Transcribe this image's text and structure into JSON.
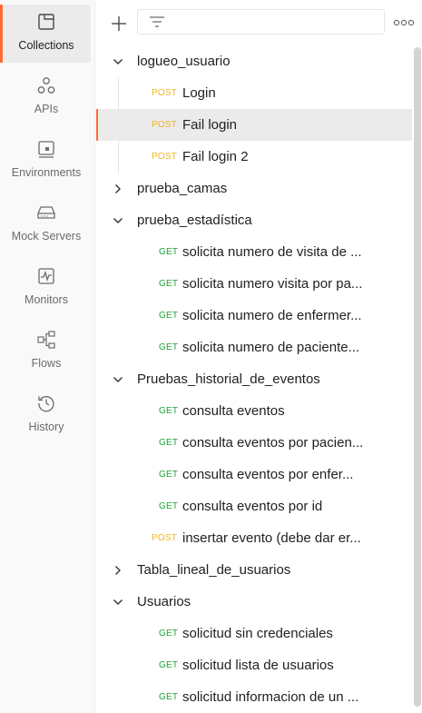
{
  "sidebar": {
    "items": [
      {
        "label": "Collections",
        "icon": "collections-icon",
        "active": true
      },
      {
        "label": "APIs",
        "icon": "apis-icon",
        "active": false
      },
      {
        "label": "Environments",
        "icon": "environments-icon",
        "active": false
      },
      {
        "label": "Mock Servers",
        "icon": "mock-servers-icon",
        "active": false
      },
      {
        "label": "Monitors",
        "icon": "monitors-icon",
        "active": false
      },
      {
        "label": "Flows",
        "icon": "flows-icon",
        "active": false
      },
      {
        "label": "History",
        "icon": "history-icon",
        "active": false
      }
    ]
  },
  "colors": {
    "accent": "#ff6c37",
    "post": "#f0b429",
    "get": "#1fa33a"
  },
  "tree": {
    "folders": [
      {
        "name": "logueo_usuario",
        "expanded": true
      },
      {
        "name": "prueba_camas",
        "expanded": false
      },
      {
        "name": "prueba_estadística",
        "expanded": true
      },
      {
        "name": "Pruebas_historial_de_eventos",
        "expanded": true
      },
      {
        "name": "Tabla_lineal_de_usuarios",
        "expanded": false
      },
      {
        "name": "Usuarios",
        "expanded": true
      }
    ],
    "requests": [
      {
        "method": "POST",
        "name": "Login"
      },
      {
        "method": "POST",
        "name": "Fail login",
        "selected": true
      },
      {
        "method": "POST",
        "name": "Fail login 2"
      },
      {
        "method": "GET",
        "name": "solicita numero de visita de ..."
      },
      {
        "method": "GET",
        "name": "solicita numero visita por pa..."
      },
      {
        "method": "GET",
        "name": "solicita numero de enfermer..."
      },
      {
        "method": "GET",
        "name": "solicita numero de paciente..."
      },
      {
        "method": "GET",
        "name": "consulta eventos"
      },
      {
        "method": "GET",
        "name": "consulta eventos por pacien..."
      },
      {
        "method": "GET",
        "name": "consulta eventos por enfer..."
      },
      {
        "method": "GET",
        "name": "consulta eventos por id"
      },
      {
        "method": "POST",
        "name": "insertar evento (debe dar er..."
      },
      {
        "method": "GET",
        "name": "solicitud sin credenciales"
      },
      {
        "method": "GET",
        "name": "solicitud lista de usuarios"
      },
      {
        "method": "GET",
        "name": "solicitud informacion de un ..."
      }
    ]
  }
}
